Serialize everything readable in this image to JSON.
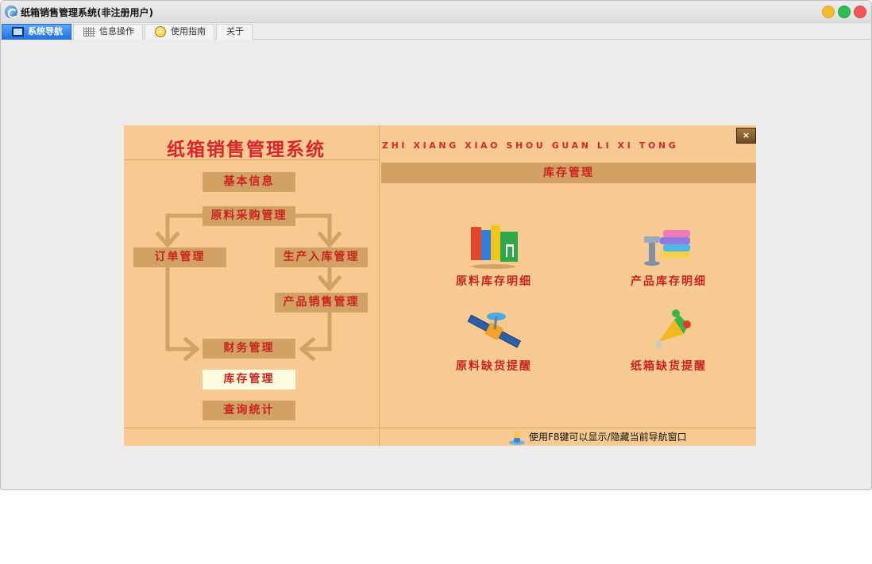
{
  "window": {
    "title": "纸箱销售管理系统(非注册用户)"
  },
  "tabs": [
    {
      "label": "系统导航",
      "active": true
    },
    {
      "label": "信息操作",
      "active": false
    },
    {
      "label": "使用指南",
      "active": false
    },
    {
      "label": "关于",
      "active": false
    }
  ],
  "panel": {
    "title": "纸箱销售管理系统",
    "pinyin": "ZHI XIANG XIAO SHOU GUAN LI XI TONG",
    "close_label": "×",
    "flow": {
      "basic_info": "基本信息",
      "material_purchase": "原料采购管理",
      "orders": "订单管理",
      "production_in": "生产入库管理",
      "product_sales": "产品销售管理",
      "finance": "财务管理",
      "inventory": "库存管理",
      "query_stats": "查询统计"
    },
    "section_title": "库存管理",
    "modules": [
      {
        "label": "原料库存明细",
        "icon": "books-icon"
      },
      {
        "label": "产品库存明细",
        "icon": "stacked-books-icon"
      },
      {
        "label": "原料缺货提醒",
        "icon": "satellite-icon"
      },
      {
        "label": "纸箱缺货提醒",
        "icon": "megaphone-icon"
      }
    ],
    "hint": "使用F8键可以显示/隐藏当前导航窗口"
  },
  "colors": {
    "panel_bg": "#f6ca90",
    "button_bg": "#d2a264",
    "selected_bg": "#fffbe0",
    "accent_red": "#d8262c",
    "tab_active": "#1e6fe0"
  }
}
